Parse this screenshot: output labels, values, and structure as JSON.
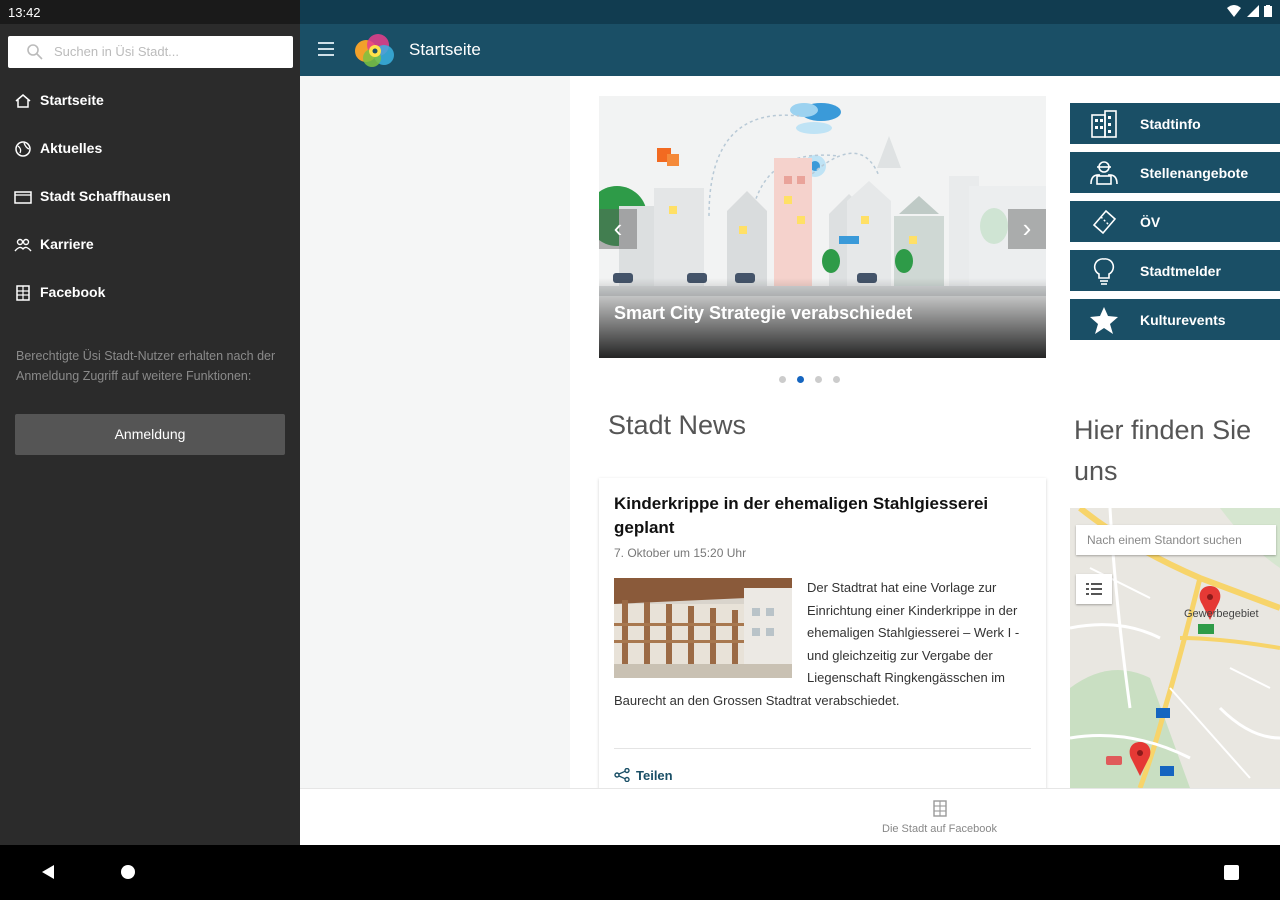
{
  "status_bar": {
    "time": "13:42"
  },
  "drawer": {
    "search_placeholder": "Suchen in Üsi Stadt...",
    "items": [
      {
        "label": "Startseite",
        "icon": "home-icon"
      },
      {
        "label": "Aktuelles",
        "icon": "globe-icon"
      },
      {
        "label": "Stadt Schaffhausen",
        "icon": "folder-icon"
      },
      {
        "label": "Karriere",
        "icon": "people-icon"
      },
      {
        "label": "Facebook",
        "icon": "building-icon"
      }
    ],
    "hint": "Berechtigte Üsi Stadt-Nutzer erhalten nach der Anmeldung Zugriff auf weitere Funktionen:",
    "login_label": "Anmeldung"
  },
  "appbar": {
    "title": "Startseite"
  },
  "carousel": {
    "caption": "Smart City Strategie verabschiedet",
    "slide_count": 4,
    "active_slide": 2
  },
  "quick_links": [
    {
      "label": "Stadtinfo",
      "icon": "building-icon"
    },
    {
      "label": "Stellenangebote",
      "icon": "workers-icon"
    },
    {
      "label": "ÖV",
      "icon": "ticket-icon"
    },
    {
      "label": "Stadtmelder",
      "icon": "lightbulb-icon"
    },
    {
      "label": "Kulturevents",
      "icon": "star-icon"
    }
  ],
  "news": {
    "section_title": "Stadt News",
    "headline": "Kinderkrippe in der ehemaligen Stahlgiesserei geplant",
    "date": "7. Oktober um 15:20 Uhr",
    "body": "Der Stadtrat hat eine Vorlage zur Einrichtung einer Kinderkrippe in der ehemaligen Stahlgiesserei – Werk I - und gleichzeitig zur Vergabe der Liegenschaft Ringkengässchen im Baurecht an den Grossen Stadtrat verabschiedet.",
    "share_label": "Teilen"
  },
  "location": {
    "section_title": "Hier finden Sie uns",
    "map_search_placeholder": "Nach einem Standort suchen",
    "map_label_area": "Gewerbegebiet"
  },
  "bottom_tab": {
    "label": "Die Stadt auf Facebook"
  },
  "colors": {
    "primary": "#1a4f66",
    "drawer_bg": "#2b2b2b",
    "accent_dot": "#1565c0"
  }
}
